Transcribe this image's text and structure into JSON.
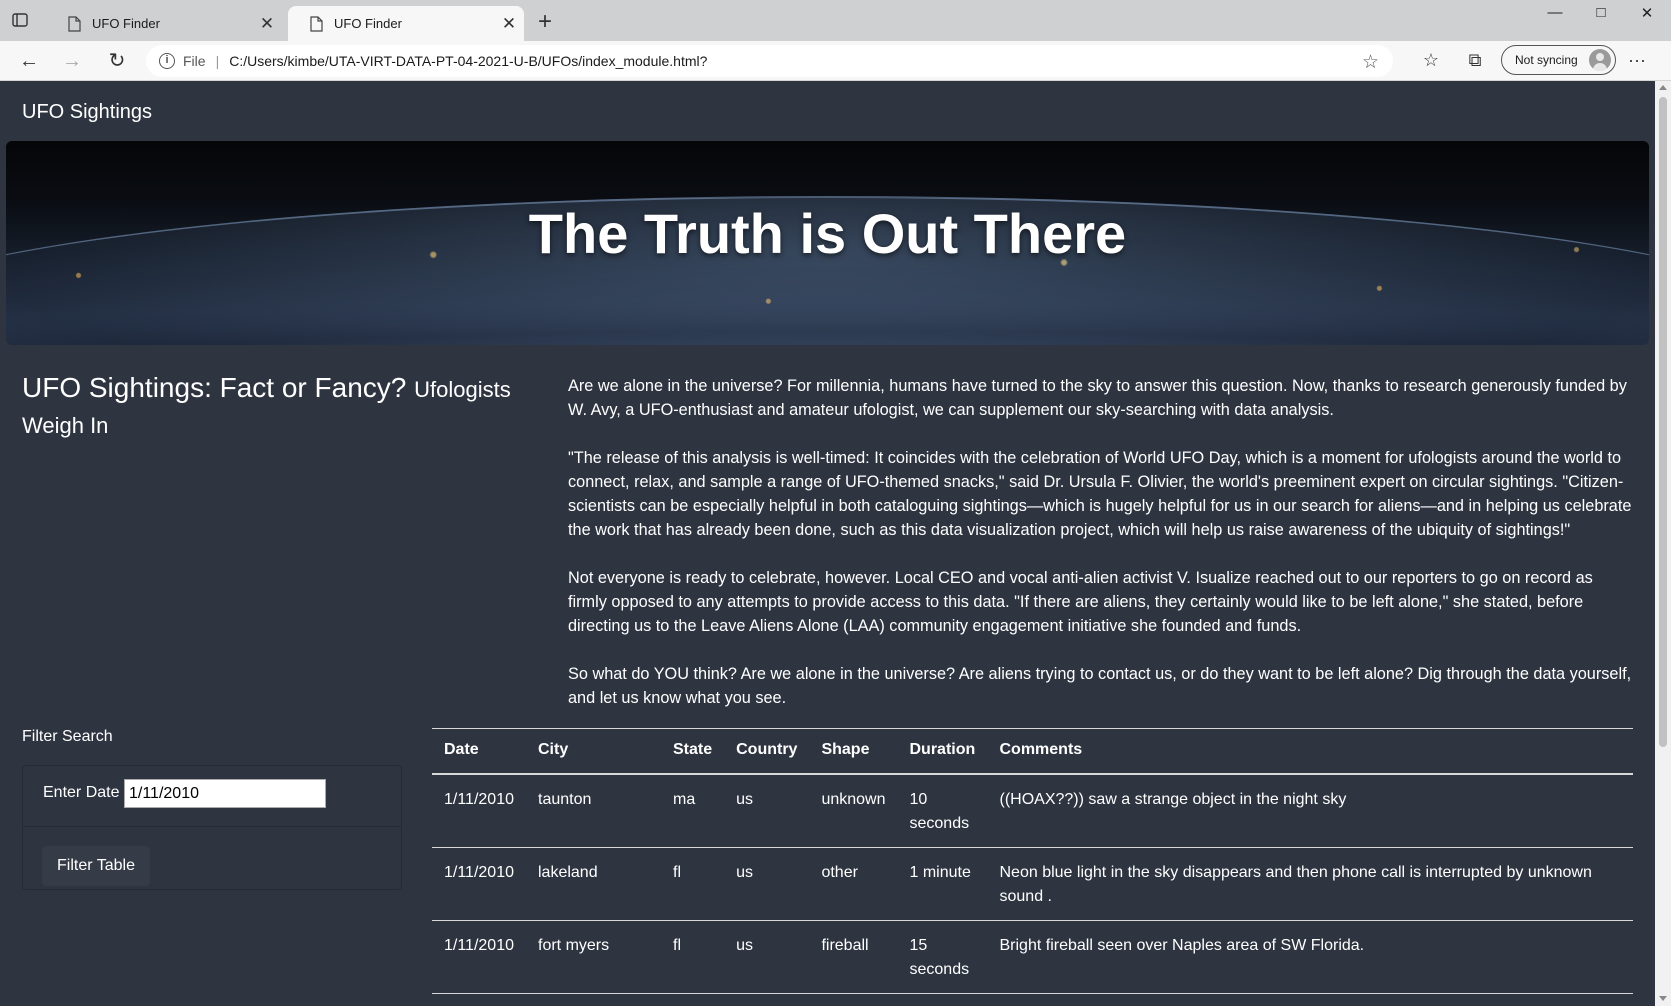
{
  "browser": {
    "tabs": [
      {
        "title": "UFO Finder",
        "active": false
      },
      {
        "title": "UFO Finder",
        "active": true
      }
    ],
    "address": {
      "file_label": "File",
      "url": "C:/Users/kimbe/UTA-VIRT-DATA-PT-04-2021-U-B/UFOs/index_module.html?"
    },
    "sync_label": "Not syncing"
  },
  "page": {
    "brand": "UFO Sightings",
    "hero_title": "The Truth is Out There",
    "section_title": "UFO Sightings: Fact or Fancy?",
    "section_subtitle": "Ufologists Weigh In",
    "article": [
      "Are we alone in the universe? For millennia, humans have turned to the sky to answer this question. Now, thanks to research generously funded by W. Avy, a UFO-enthusiast and amateur ufologist, we can supplement our sky-searching with data analysis.",
      "\"The release of this analysis is well-timed: It coincides with the celebration of World UFO Day, which is a moment for ufologists around the world to connect, relax, and sample a range of UFO-themed snacks,\" said Dr. Ursula F. Olivier, the world's preeminent expert on circular sightings. \"Citizen-scientists can be especially helpful in both cataloguing sightings—which is hugely helpful for us in our search for aliens—and in helping us celebrate the work that has already been done, such as this data visualization project, which will help us raise awareness of the ubiquity of sightings!\"",
      "Not everyone is ready to celebrate, however. Local CEO and vocal anti-alien activist V. Isualize reached out to our reporters to go on record as firmly opposed to any attempts to provide access to this data. \"If there are aliens, they certainly would like to be left alone,\" she stated, before directing us to the Leave Aliens Alone (LAA) community engagement initiative she founded and funds.",
      "So what do YOU think? Are we alone in the universe? Are aliens trying to contact us, or do they want to be left alone? Dig through the data yourself, and let us know what you see."
    ],
    "filter": {
      "heading": "Filter Search",
      "date_label": "Enter Date",
      "date_value": "1/11/2010",
      "button_label": "Filter Table"
    },
    "table": {
      "headers": [
        "Date",
        "City",
        "State",
        "Country",
        "Shape",
        "Duration",
        "Comments"
      ],
      "rows": [
        [
          "1/11/2010",
          "taunton",
          "ma",
          "us",
          "unknown",
          "10 seconds",
          "((HOAX??)) saw a strange object in the night sky"
        ],
        [
          "1/11/2010",
          "lakeland",
          "fl",
          "us",
          "other",
          "1 minute",
          "Neon blue light in the sky disappears and then phone call is interrupted by unknown sound ."
        ],
        [
          "1/11/2010",
          "fort myers",
          "fl",
          "us",
          "fireball",
          "15 seconds",
          "Bright fireball seen over Naples area of SW Florida."
        ]
      ]
    }
  }
}
